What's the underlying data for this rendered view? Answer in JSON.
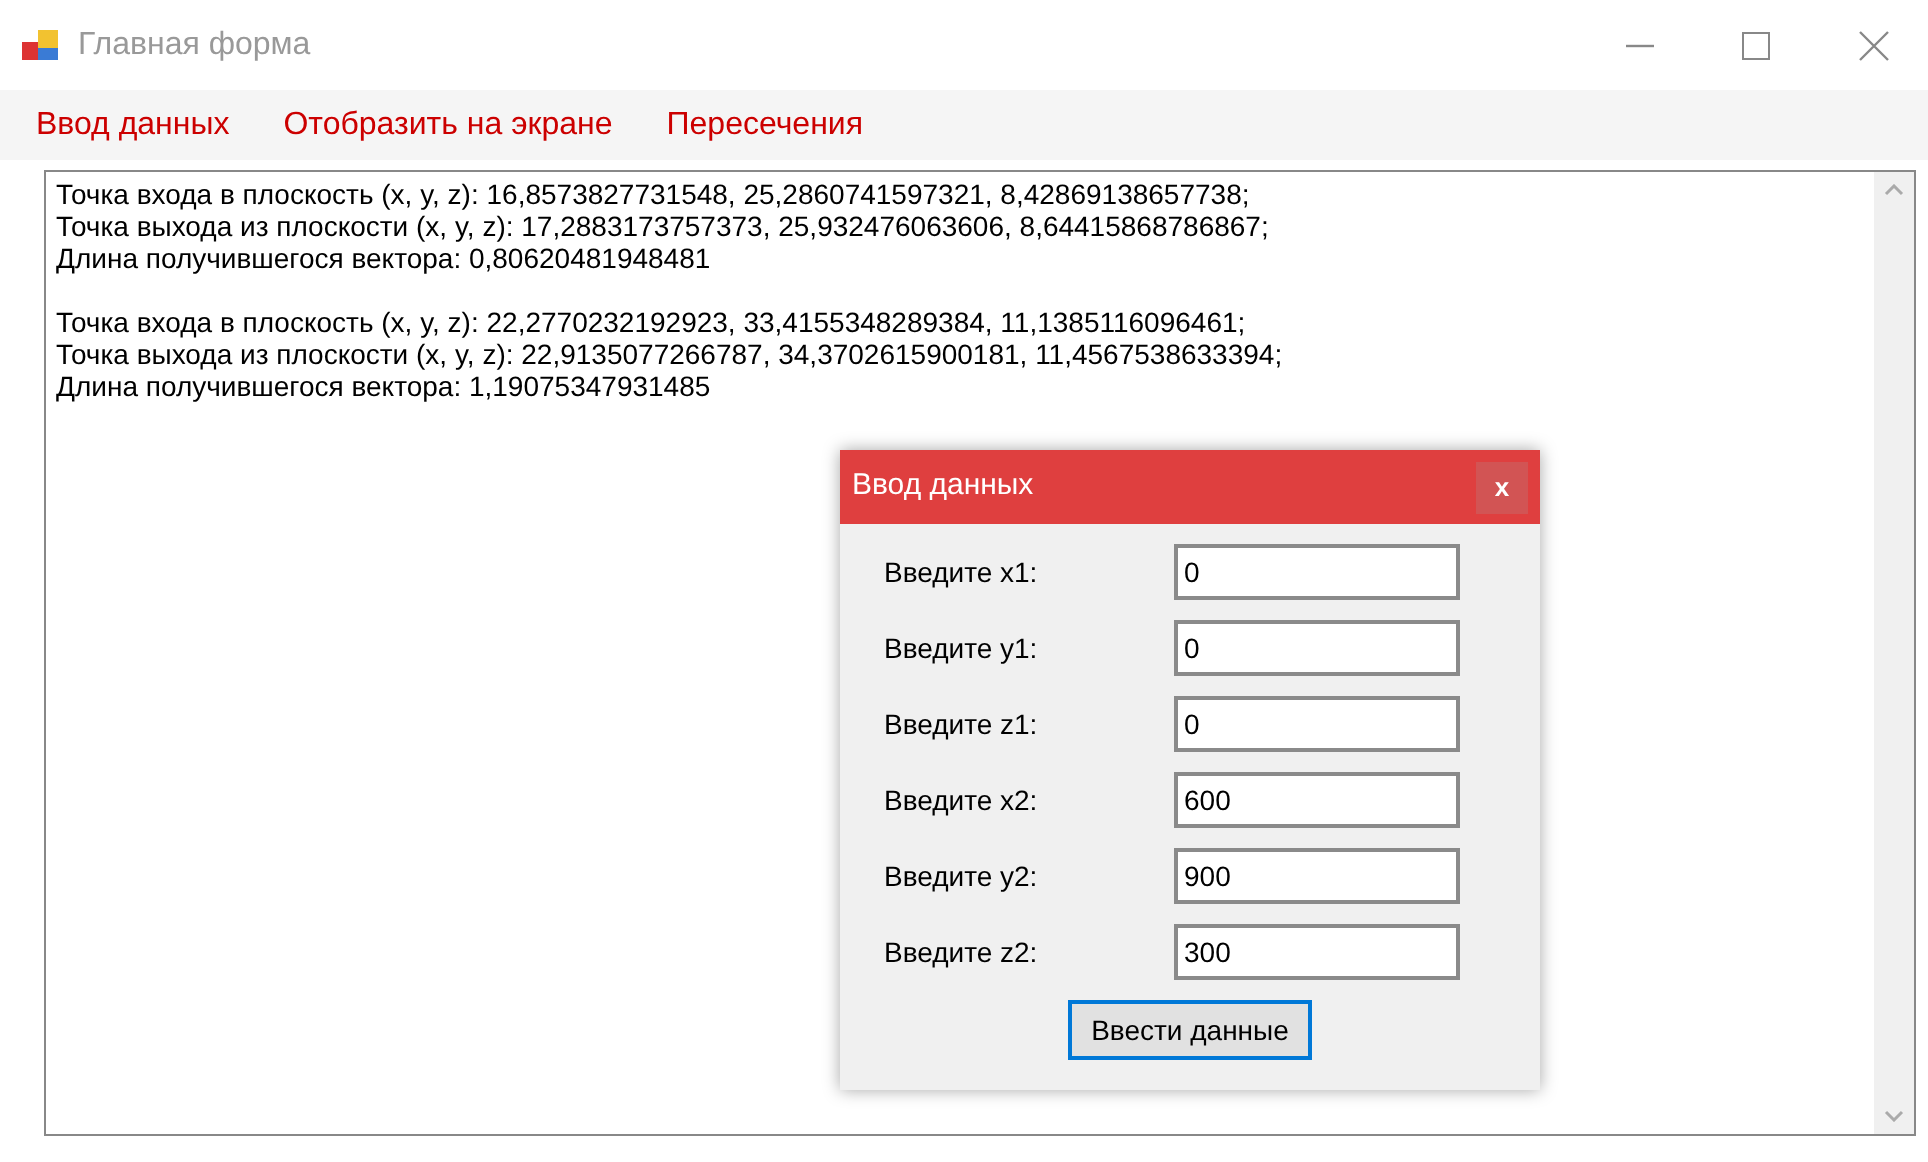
{
  "window": {
    "title": "Главная форма"
  },
  "menu": [
    {
      "label": "Ввод данных"
    },
    {
      "label": "Отобразить на экране"
    },
    {
      "label": "Пересечения"
    }
  ],
  "output": {
    "blocks": [
      {
        "lines": [
          "Точка входа в плоскость (x, y, z): 16,8573827731548, 25,2860741597321, 8,42869138657738;",
          "Точка выхода из плоскости (x, y, z): 17,2883173757373, 25,932476063606, 8,64415868786867;",
          "Длина получившегося вектора: 0,80620481948481"
        ]
      },
      {
        "lines": [
          "Точка входа в плоскость (x, y, z): 22,2770232192923, 33,4155348289384, 11,1385116096461;",
          "Точка выхода из плоскости (x, y, z): 22,9135077266787, 34,3702615900181, 11,4567538633394;",
          "Длина получившегося вектора: 1,19075347931485"
        ]
      }
    ]
  },
  "dialog": {
    "title": "Ввод данных",
    "close": "x",
    "fields": [
      {
        "label": "Введите x1:",
        "value": "0"
      },
      {
        "label": "Введите y1:",
        "value": "0"
      },
      {
        "label": "Введите z1:",
        "value": "0"
      },
      {
        "label": "Введите x2:",
        "value": "600"
      },
      {
        "label": "Введите y2:",
        "value": "900"
      },
      {
        "label": "Введите z2:",
        "value": "300"
      }
    ],
    "button": "Ввести данные"
  }
}
